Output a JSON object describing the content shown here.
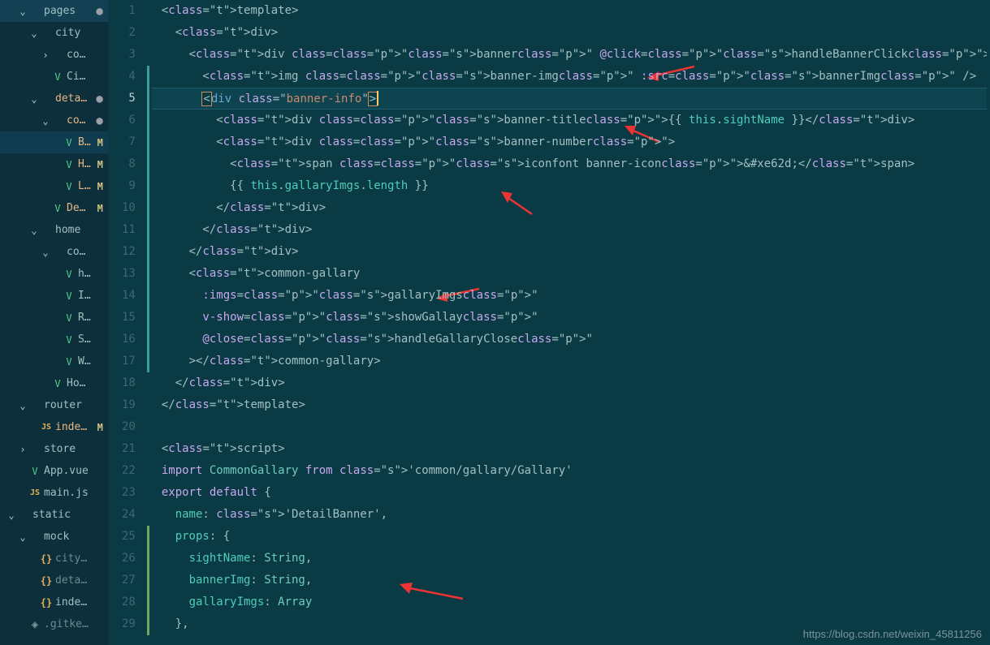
{
  "sidebar": {
    "items": [
      {
        "label": "pages",
        "depth": 0,
        "caret": "down",
        "icon": "",
        "dim": false,
        "status": "dot",
        "folder": true
      },
      {
        "label": "city",
        "depth": 1,
        "caret": "down",
        "icon": "",
        "folder": true
      },
      {
        "label": "components",
        "depth": 2,
        "caret": "right",
        "icon": "",
        "folder": true
      },
      {
        "label": "City.vue",
        "depth": 2,
        "caret": "blank",
        "icon": "vue"
      },
      {
        "label": "detail",
        "depth": 1,
        "caret": "down",
        "icon": "",
        "status": "dot",
        "folder": true,
        "labelClass": "orange"
      },
      {
        "label": "components",
        "depth": 2,
        "caret": "down",
        "icon": "",
        "status": "dot",
        "folder": true,
        "labelClass": "orange"
      },
      {
        "label": "Banner.vue",
        "depth": 3,
        "caret": "blank",
        "icon": "vue",
        "status": "M",
        "selected": true,
        "active": true,
        "labelClass": "orange"
      },
      {
        "label": "Header.vue",
        "depth": 3,
        "caret": "blank",
        "icon": "vue",
        "status": "M",
        "labelClass": "orange"
      },
      {
        "label": "List.vue",
        "depth": 3,
        "caret": "blank",
        "icon": "vue",
        "status": "M",
        "labelClass": "orange"
      },
      {
        "label": "Detail.vue",
        "depth": 2,
        "caret": "blank",
        "icon": "vue",
        "status": "M",
        "labelClass": "orange"
      },
      {
        "label": "home",
        "depth": 1,
        "caret": "down",
        "icon": "",
        "folder": true
      },
      {
        "label": "components",
        "depth": 2,
        "caret": "down",
        "icon": "",
        "folder": true
      },
      {
        "label": "header.vue",
        "depth": 3,
        "caret": "blank",
        "icon": "vue"
      },
      {
        "label": "Icons.vue",
        "depth": 3,
        "caret": "blank",
        "icon": "vue"
      },
      {
        "label": "Recommend.vue",
        "depth": 3,
        "caret": "blank",
        "icon": "vue"
      },
      {
        "label": "Swiper.vue",
        "depth": 3,
        "caret": "blank",
        "icon": "vue"
      },
      {
        "label": "Weekend.vue",
        "depth": 3,
        "caret": "blank",
        "icon": "vue"
      },
      {
        "label": "Home.vue",
        "depth": 2,
        "caret": "blank",
        "icon": "vue"
      },
      {
        "label": "router",
        "depth": 0,
        "caret": "down",
        "icon": "",
        "folder": true
      },
      {
        "label": "index.js",
        "depth": 1,
        "caret": "blank",
        "icon": "js",
        "status": "M",
        "labelClass": "orange"
      },
      {
        "label": "store",
        "depth": 0,
        "caret": "right",
        "icon": "",
        "folder": true
      },
      {
        "label": "App.vue",
        "depth": 0,
        "caret": "blank",
        "icon": "vue"
      },
      {
        "label": "main.js",
        "depth": 0,
        "caret": "blank",
        "icon": "js"
      },
      {
        "label": "static",
        "depth": -1,
        "caret": "down",
        "icon": "",
        "folder": true
      },
      {
        "label": "mock",
        "depth": 0,
        "caret": "down",
        "icon": "",
        "folder": true
      },
      {
        "label": "city.json",
        "depth": 1,
        "caret": "blank",
        "icon": "json",
        "dim": true
      },
      {
        "label": "detail.json",
        "depth": 1,
        "caret": "blank",
        "icon": "json",
        "dim": true
      },
      {
        "label": "index.json",
        "depth": 1,
        "caret": "blank",
        "icon": "json"
      },
      {
        "label": ".gitkeep",
        "depth": 0,
        "caret": "blank",
        "icon": "gear",
        "dim": true
      }
    ]
  },
  "gutter": {
    "start": 1,
    "end": 29,
    "current": 5
  },
  "code": {
    "lines": [
      "<template>",
      "  <div>",
      "    <div class=\"banner\" @click=\"handleBannerClick\">",
      "      <img class=\"banner-img\" :src=\"bannerImg\" />",
      "      <div class=\"banner-info\">",
      "        <div class=\"banner-title\">{{ this.sightName }}</div>",
      "        <div class=\"banner-number\">",
      "          <span class=\"iconfont banner-icon\">&#xe62d;</span>",
      "          {{this.gallaryImgs.length}}",
      "        </div>",
      "      </div>",
      "    </div>",
      "    <common-gallary",
      "      :imgs=\"gallaryImgs\"",
      "      v-show=\"showGallay\"",
      "      @close=\"handleGallaryClose\"",
      "    ></common-gallary>",
      "  </div>",
      "</template>",
      "",
      "<script>",
      "import CommonGallary from 'common/gallary/Gallary'",
      "export default {",
      "  name: 'DetailBanner',",
      "  props: {",
      "    sightName: String,",
      "    bannerImg: String,",
      "    gallaryImgs: Array",
      "  },"
    ]
  },
  "watermark": "https://blog.csdn.net/weixin_45811256",
  "glyph": {
    "chev_down": "⌄",
    "chev_right": "›",
    "vue": "V",
    "js": "JS",
    "json": "{}",
    "gear": "◈",
    "dot": "●"
  }
}
